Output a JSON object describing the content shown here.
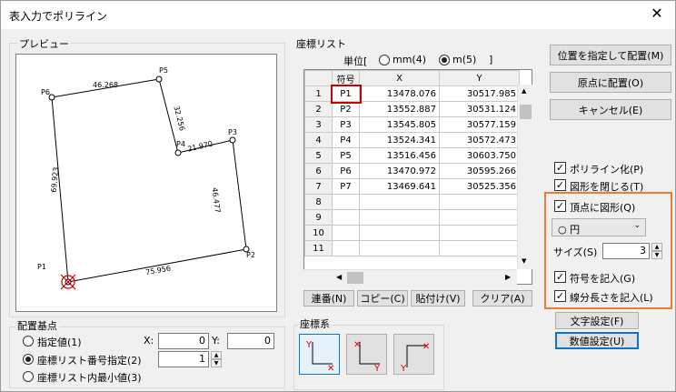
{
  "window": {
    "title": "表入力でポリライン",
    "close_glyph": "✕"
  },
  "preview": {
    "group_label": "プレビュー",
    "points": [
      "P1",
      "P2",
      "P3",
      "P4",
      "P5",
      "P6"
    ],
    "lengths": [
      "46.268",
      "32.256",
      "21.970",
      "46.477",
      "75.956",
      "69.923"
    ]
  },
  "coords": {
    "group_label": "座標リスト",
    "unit_label": "単位[",
    "unit_close": "]",
    "unit_mm": "mm(4)",
    "unit_m": "m(5)",
    "headers": [
      "",
      "符号",
      "X",
      "Y"
    ],
    "rows": [
      {
        "n": "1",
        "sym": "P1",
        "x": "13478.076",
        "y": "30517.985"
      },
      {
        "n": "2",
        "sym": "P2",
        "x": "13552.887",
        "y": "30531.124"
      },
      {
        "n": "3",
        "sym": "P3",
        "x": "13545.805",
        "y": "30577.159"
      },
      {
        "n": "4",
        "sym": "P4",
        "x": "13524.341",
        "y": "30572.473"
      },
      {
        "n": "5",
        "sym": "P5",
        "x": "13516.456",
        "y": "30603.750"
      },
      {
        "n": "6",
        "sym": "P6",
        "x": "13470.972",
        "y": "30595.266"
      },
      {
        "n": "7",
        "sym": "P7",
        "x": "13469.641",
        "y": "30525.356"
      },
      {
        "n": "8",
        "sym": "",
        "x": "",
        "y": ""
      },
      {
        "n": "9",
        "sym": "",
        "x": "",
        "y": ""
      },
      {
        "n": "10",
        "sym": "",
        "x": "",
        "y": ""
      },
      {
        "n": "11",
        "sym": "",
        "x": "",
        "y": ""
      }
    ],
    "btn_renban": "連番(N)",
    "btn_copy": "コピー(C)",
    "btn_paste": "貼付け(V)",
    "btn_clear": "クリア(A)"
  },
  "right": {
    "btn_place_at": "位置を指定して配置(M)",
    "btn_place_origin": "原点に配置(O)",
    "btn_cancel": "キャンセル(E)",
    "chk_polyline": "ポリライン化(P)",
    "chk_close": "図形を閉じる(T)",
    "chk_vertex_shape": "頂点に図形(Q)",
    "shape_select": "○ 円",
    "size_label": "サイズ(S)",
    "size_value": "3",
    "chk_symbol": "符号を記入(G)",
    "chk_length": "線分長さを記入(L)",
    "btn_text_settings": "文字設定(F)",
    "btn_number_settings": "数値設定(U)"
  },
  "base": {
    "group_label": "配置基点",
    "opt_value": "指定値(1)",
    "opt_list_no": "座標リスト番号指定(2)",
    "opt_list_min": "座標リスト内最小値(3)",
    "x_label": "X:",
    "y_label": "Y:",
    "x_value": "0",
    "y_value": "0",
    "list_no_value": "1"
  },
  "coord_sys": {
    "group_label": "座標系"
  }
}
